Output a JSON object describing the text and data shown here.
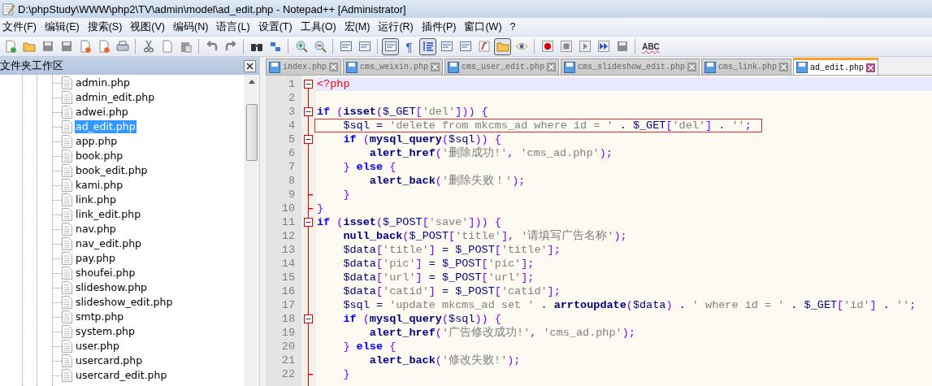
{
  "window": {
    "title": "D:\\phpStudy\\WWW\\php2\\TV\\admin\\model\\ad_edit.php - Notepad++ [Administrator]"
  },
  "menu": [
    "文件(F)",
    "编辑(E)",
    "搜索(S)",
    "视图(V)",
    "编码(N)",
    "语言(L)",
    "设置(T)",
    "工具(O)",
    "宏(M)",
    "运行(R)",
    "插件(P)",
    "窗口(W)",
    "?"
  ],
  "toolbar": [
    {
      "pressed": false
    },
    {
      "pressed": false
    },
    {
      "pressed": false
    },
    {
      "pressed": false
    },
    {
      "pressed": false
    },
    {
      "pressed": false
    },
    {
      "pressed": false
    },
    {
      "pressed": false
    },
    {
      "pressed": false
    },
    {
      "pressed": false
    },
    {
      "pressed": false
    },
    {
      "pressed": false
    },
    {
      "pressed": false
    },
    {
      "pressed": false
    },
    {
      "pressed": false
    },
    {
      "pressed": false
    },
    {
      "pressed": false
    },
    {
      "pressed": false
    },
    {
      "pressed": true
    },
    {
      "pressed": false,
      "text": "¶"
    },
    {
      "pressed": true
    },
    {
      "pressed": false
    },
    {
      "pressed": false
    },
    {
      "pressed": false
    },
    {
      "pressed": true
    },
    {
      "pressed": false
    },
    {
      "pressed": false
    },
    {
      "pressed": false
    },
    {
      "pressed": false
    },
    {
      "pressed": false
    },
    {
      "pressed": false
    },
    {
      "pressed": false,
      "text": "ABC"
    }
  ],
  "sidebar": {
    "title": "文件夹工作区",
    "items": [
      {
        "label": "admin.php",
        "selected": false
      },
      {
        "label": "admin_edit.php",
        "selected": false
      },
      {
        "label": "adwei.php",
        "selected": false
      },
      {
        "label": "ad_edit.php",
        "selected": true
      },
      {
        "label": "app.php",
        "selected": false
      },
      {
        "label": "book.php",
        "selected": false
      },
      {
        "label": "book_edit.php",
        "selected": false
      },
      {
        "label": "kami.php",
        "selected": false
      },
      {
        "label": "link.php",
        "selected": false
      },
      {
        "label": "link_edit.php",
        "selected": false
      },
      {
        "label": "nav.php",
        "selected": false
      },
      {
        "label": "nav_edit.php",
        "selected": false
      },
      {
        "label": "pay.php",
        "selected": false
      },
      {
        "label": "shoufei.php",
        "selected": false
      },
      {
        "label": "slideshow.php",
        "selected": false
      },
      {
        "label": "slideshow_edit.php",
        "selected": false
      },
      {
        "label": "smtp.php",
        "selected": false
      },
      {
        "label": "system.php",
        "selected": false
      },
      {
        "label": "user.php",
        "selected": false
      },
      {
        "label": "usercard.php",
        "selected": false
      },
      {
        "label": "usercard_edit.php",
        "selected": false
      }
    ]
  },
  "tabs": [
    {
      "label": "index.php",
      "selected": false
    },
    {
      "label": "cms_weixin.php",
      "selected": false
    },
    {
      "label": "cms_user_edit.php",
      "selected": false
    },
    {
      "label": "cms_slideshow_edit.php",
      "selected": false
    },
    {
      "label": "cms_link.php",
      "selected": false
    },
    {
      "label": "ad_edit.php",
      "selected": true
    }
  ],
  "editor": {
    "lines": [
      {
        "number": "1",
        "fold_start": true,
        "fold_end": false,
        "current": true,
        "boxed": false,
        "tokens": [
          {
            "kind": "tag",
            "text": "<?php"
          }
        ]
      },
      {
        "number": "2",
        "fold_start": false,
        "fold_end": false,
        "current": false,
        "boxed": false
      },
      {
        "number": "3",
        "fold_start": true,
        "fold_end": false,
        "current": false,
        "boxed": false,
        "tokens": [
          {
            "kind": "kw",
            "text": "if "
          },
          {
            "kind": "punc",
            "text": "("
          },
          {
            "kind": "fn",
            "text": "isset"
          },
          {
            "kind": "punc",
            "text": "("
          },
          {
            "kind": "var",
            "text": "$_GET"
          },
          {
            "kind": "punc",
            "text": "["
          },
          {
            "kind": "str",
            "text": "'del'"
          },
          {
            "kind": "punc",
            "text": "])) {"
          }
        ]
      },
      {
        "number": "4",
        "fold_start": false,
        "fold_end": false,
        "current": false,
        "boxed": true,
        "tokens": [
          {
            "kind": "var",
            "text": "    $sql"
          },
          {
            "kind": "op",
            "text": " = "
          },
          {
            "kind": "str",
            "text": "'delete from mkcms_ad where id = '"
          },
          {
            "kind": "op",
            "text": " . "
          },
          {
            "kind": "var",
            "text": "$_GET"
          },
          {
            "kind": "punc",
            "text": "["
          },
          {
            "kind": "str",
            "text": "'del'"
          },
          {
            "kind": "punc",
            "text": "]"
          },
          {
            "kind": "op",
            "text": " . "
          },
          {
            "kind": "str",
            "text": "''"
          },
          {
            "kind": "punc",
            "text": ";"
          }
        ]
      },
      {
        "number": "5",
        "fold_start": true,
        "fold_end": false,
        "current": false,
        "boxed": false,
        "tokens": [
          {
            "kind": "kw",
            "text": "    if "
          },
          {
            "kind": "punc",
            "text": "("
          },
          {
            "kind": "fn",
            "text": "mysql_query"
          },
          {
            "kind": "punc",
            "text": "("
          },
          {
            "kind": "var",
            "text": "$sql"
          },
          {
            "kind": "punc",
            "text": ")) {"
          }
        ]
      },
      {
        "number": "6",
        "fold_start": false,
        "fold_end": false,
        "current": false,
        "boxed": false,
        "tokens": [
          {
            "kind": "fn",
            "text": "        alert_href"
          },
          {
            "kind": "punc",
            "text": "("
          },
          {
            "kind": "str",
            "text": "'删除成功!'"
          },
          {
            "kind": "punc",
            "text": ", "
          },
          {
            "kind": "str",
            "text": "'cms_ad.php'"
          },
          {
            "kind": "punc",
            "text": ");"
          }
        ]
      },
      {
        "number": "7",
        "fold_start": false,
        "fold_end": false,
        "current": false,
        "boxed": false,
        "tokens": [
          {
            "kind": "punc",
            "text": "    } "
          },
          {
            "kind": "kw",
            "text": "else "
          },
          {
            "kind": "punc",
            "text": "{"
          }
        ]
      },
      {
        "number": "8",
        "fold_start": false,
        "fold_end": false,
        "current": false,
        "boxed": false,
        "tokens": [
          {
            "kind": "fn",
            "text": "        alert_back"
          },
          {
            "kind": "punc",
            "text": "("
          },
          {
            "kind": "str",
            "text": "'删除失败！'"
          },
          {
            "kind": "punc",
            "text": ");"
          }
        ]
      },
      {
        "number": "9",
        "fold_start": false,
        "fold_end": true,
        "current": false,
        "boxed": false,
        "tokens": [
          {
            "kind": "punc",
            "text": "    }"
          }
        ]
      },
      {
        "number": "10",
        "fold_start": false,
        "fold_end": true,
        "current": false,
        "boxed": false,
        "tokens": [
          {
            "kind": "punc",
            "text": "}"
          }
        ]
      },
      {
        "number": "11",
        "fold_start": true,
        "fold_end": false,
        "current": false,
        "boxed": false,
        "tokens": [
          {
            "kind": "kw",
            "text": "if "
          },
          {
            "kind": "punc",
            "text": "("
          },
          {
            "kind": "fn",
            "text": "isset"
          },
          {
            "kind": "punc",
            "text": "("
          },
          {
            "kind": "var",
            "text": "$_POST"
          },
          {
            "kind": "punc",
            "text": "["
          },
          {
            "kind": "str",
            "text": "'save'"
          },
          {
            "kind": "punc",
            "text": "])) {"
          }
        ]
      },
      {
        "number": "12",
        "fold_start": false,
        "fold_end": false,
        "current": false,
        "boxed": false,
        "tokens": [
          {
            "kind": "fn",
            "text": "    null_back"
          },
          {
            "kind": "punc",
            "text": "("
          },
          {
            "kind": "var",
            "text": "$_POST"
          },
          {
            "kind": "punc",
            "text": "["
          },
          {
            "kind": "str",
            "text": "'title'"
          },
          {
            "kind": "punc",
            "text": "], "
          },
          {
            "kind": "str",
            "text": "'请填写广告名称'"
          },
          {
            "kind": "punc",
            "text": ");"
          }
        ]
      },
      {
        "number": "13",
        "fold_start": false,
        "fold_end": false,
        "current": false,
        "boxed": false,
        "tokens": [
          {
            "kind": "var",
            "text": "    $data"
          },
          {
            "kind": "punc",
            "text": "["
          },
          {
            "kind": "str",
            "text": "'title'"
          },
          {
            "kind": "punc",
            "text": "]"
          },
          {
            "kind": "op",
            "text": " = "
          },
          {
            "kind": "var",
            "text": "$_POST"
          },
          {
            "kind": "punc",
            "text": "["
          },
          {
            "kind": "str",
            "text": "'title'"
          },
          {
            "kind": "punc",
            "text": "];"
          }
        ]
      },
      {
        "number": "14",
        "fold_start": false,
        "fold_end": false,
        "current": false,
        "boxed": false,
        "tokens": [
          {
            "kind": "var",
            "text": "    $data"
          },
          {
            "kind": "punc",
            "text": "["
          },
          {
            "kind": "str",
            "text": "'pic'"
          },
          {
            "kind": "punc",
            "text": "]"
          },
          {
            "kind": "op",
            "text": " = "
          },
          {
            "kind": "var",
            "text": "$_POST"
          },
          {
            "kind": "punc",
            "text": "["
          },
          {
            "kind": "str",
            "text": "'pic'"
          },
          {
            "kind": "punc",
            "text": "];"
          }
        ]
      },
      {
        "number": "15",
        "fold_start": false,
        "fold_end": false,
        "current": false,
        "boxed": false,
        "tokens": [
          {
            "kind": "var",
            "text": "    $data"
          },
          {
            "kind": "punc",
            "text": "["
          },
          {
            "kind": "str",
            "text": "'url'"
          },
          {
            "kind": "punc",
            "text": "]"
          },
          {
            "kind": "op",
            "text": " = "
          },
          {
            "kind": "var",
            "text": "$_POST"
          },
          {
            "kind": "punc",
            "text": "["
          },
          {
            "kind": "str",
            "text": "'url'"
          },
          {
            "kind": "punc",
            "text": "];"
          }
        ]
      },
      {
        "number": "16",
        "fold_start": false,
        "fold_end": false,
        "current": false,
        "boxed": false,
        "tokens": [
          {
            "kind": "var",
            "text": "    $data"
          },
          {
            "kind": "punc",
            "text": "["
          },
          {
            "kind": "str",
            "text": "'catid'"
          },
          {
            "kind": "punc",
            "text": "]"
          },
          {
            "kind": "op",
            "text": " = "
          },
          {
            "kind": "var",
            "text": "$_POST"
          },
          {
            "kind": "punc",
            "text": "["
          },
          {
            "kind": "str",
            "text": "'catid'"
          },
          {
            "kind": "punc",
            "text": "];"
          }
        ]
      },
      {
        "number": "17",
        "fold_start": false,
        "fold_end": false,
        "current": false,
        "boxed": false,
        "tokens": [
          {
            "kind": "var",
            "text": "    $sql"
          },
          {
            "kind": "op",
            "text": " = "
          },
          {
            "kind": "str",
            "text": "'update mkcms_ad set '"
          },
          {
            "kind": "op",
            "text": " . "
          },
          {
            "kind": "fn",
            "text": "arrtoupdate"
          },
          {
            "kind": "punc",
            "text": "("
          },
          {
            "kind": "var",
            "text": "$data"
          },
          {
            "kind": "punc",
            "text": ")"
          },
          {
            "kind": "op",
            "text": " . "
          },
          {
            "kind": "str",
            "text": "' where id = '"
          },
          {
            "kind": "op",
            "text": " . "
          },
          {
            "kind": "var",
            "text": "$_GET"
          },
          {
            "kind": "punc",
            "text": "["
          },
          {
            "kind": "str",
            "text": "'id'"
          },
          {
            "kind": "punc",
            "text": "]"
          },
          {
            "kind": "op",
            "text": " . "
          },
          {
            "kind": "str",
            "text": "''"
          },
          {
            "kind": "punc",
            "text": ";"
          }
        ]
      },
      {
        "number": "18",
        "fold_start": true,
        "fold_end": false,
        "current": false,
        "boxed": false,
        "tokens": [
          {
            "kind": "kw",
            "text": "    if "
          },
          {
            "kind": "punc",
            "text": "("
          },
          {
            "kind": "fn",
            "text": "mysql_query"
          },
          {
            "kind": "punc",
            "text": "("
          },
          {
            "kind": "var",
            "text": "$sql"
          },
          {
            "kind": "punc",
            "text": ")) {"
          }
        ]
      },
      {
        "number": "19",
        "fold_start": false,
        "fold_end": false,
        "current": false,
        "boxed": false,
        "tokens": [
          {
            "kind": "fn",
            "text": "        alert_href"
          },
          {
            "kind": "punc",
            "text": "("
          },
          {
            "kind": "str",
            "text": "'广告修改成功!'"
          },
          {
            "kind": "punc",
            "text": ", "
          },
          {
            "kind": "str",
            "text": "'cms_ad.php'"
          },
          {
            "kind": "punc",
            "text": ");"
          }
        ]
      },
      {
        "number": "20",
        "fold_start": false,
        "fold_end": false,
        "current": false,
        "boxed": false,
        "tokens": [
          {
            "kind": "punc",
            "text": "    } "
          },
          {
            "kind": "kw",
            "text": "else "
          },
          {
            "kind": "punc",
            "text": "{"
          }
        ]
      },
      {
        "number": "21",
        "fold_start": false,
        "fold_end": false,
        "current": false,
        "boxed": false,
        "tokens": [
          {
            "kind": "fn",
            "text": "        alert_back"
          },
          {
            "kind": "punc",
            "text": "("
          },
          {
            "kind": "str",
            "text": "'修改失败!'"
          },
          {
            "kind": "punc",
            "text": ");"
          }
        ]
      },
      {
        "number": "22",
        "fold_start": false,
        "fold_end": true,
        "current": false,
        "boxed": false,
        "tokens": [
          {
            "kind": "punc",
            "text": "    }"
          }
        ]
      }
    ]
  }
}
